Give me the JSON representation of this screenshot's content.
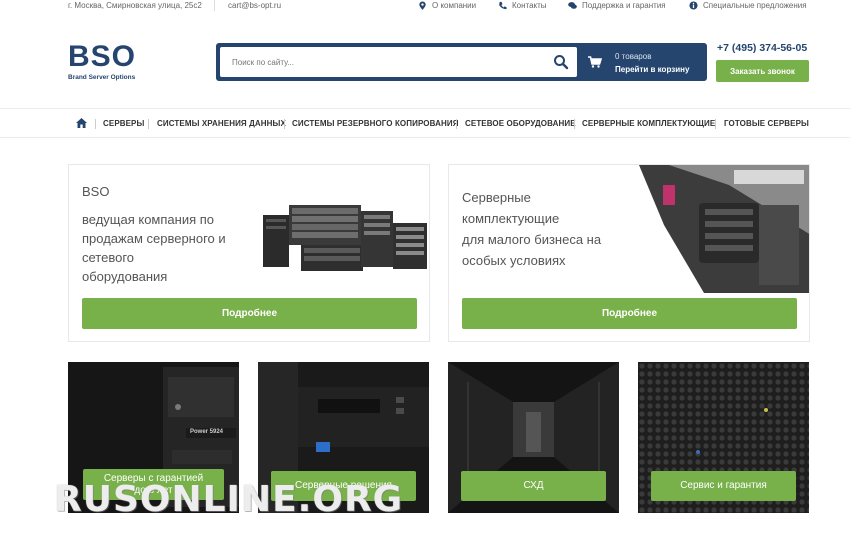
{
  "topbar": {
    "address": "г. Москва, Смирновская улица, 25с2",
    "email": "cart@bs-opt.ru",
    "links": [
      {
        "label": "О компании",
        "icon": "map-pin-icon"
      },
      {
        "label": "Контакты",
        "icon": "phone-icon"
      },
      {
        "label": "Поддержка и гарантия",
        "icon": "chat-icon"
      },
      {
        "label": "Специальные предложения",
        "icon": "info-icon"
      }
    ]
  },
  "header": {
    "logo_big": "BSO",
    "logo_small": "Brand Server Options",
    "search_placeholder": "Поиск по сайту...",
    "cart_count": "0 товаров",
    "cart_link": "Перейти в корзину",
    "phone": "+7 (495) 374-56-05",
    "callback": "Заказать звонок"
  },
  "nav": {
    "items": [
      "СЕРВЕРЫ",
      "СИСТЕМЫ ХРАНЕНИЯ ДАННЫХ",
      "СИСТЕМЫ РЕЗЕРВНОГО КОПИРОВАНИЯ",
      "СЕТЕВОЕ ОБОРУДОВАНИЕ",
      "СЕРВЕРНЫЕ КОМПЛЕКТУЮЩИЕ",
      "ГОТОВЫЕ СЕРВЕРЫ"
    ]
  },
  "promo": [
    {
      "title": "BSO",
      "lines": [
        "ведущая компания по",
        "продажам серверного и",
        "сетевого",
        "оборудования"
      ],
      "button": "Подробнее"
    },
    {
      "lines": [
        "Серверные",
        "комплектующие",
        "для малого бизнеса на",
        "особых условиях"
      ],
      "button": "Подробнее"
    }
  ],
  "tiles": [
    {
      "button_line1": "Серверы  с гарантией",
      "button_line2": "до 6 лет",
      "server_label": "Power 5924"
    },
    {
      "button": "Серверные решения"
    },
    {
      "button": "СХД"
    },
    {
      "button": "Сервис и гарантия"
    }
  ],
  "watermark": "RUSONLINE.ORG",
  "colors": {
    "brand_blue": "#25456f",
    "accent_green": "#78b04a"
  }
}
